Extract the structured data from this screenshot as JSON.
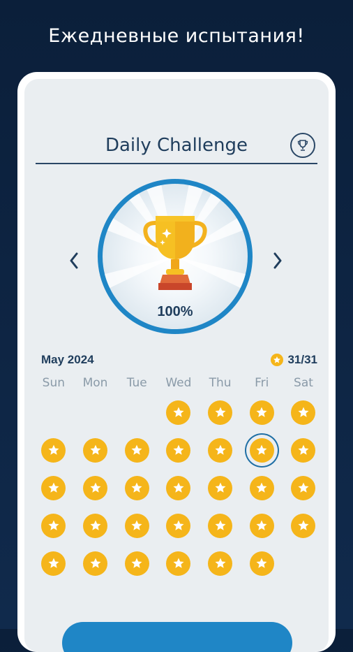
{
  "headline": "Ежедневные испытания!",
  "challenge": {
    "title": "Daily Challenge",
    "percent": "100%",
    "month": "May 2024",
    "score": "31/31"
  },
  "weekdays": [
    "Sun",
    "Mon",
    "Tue",
    "Wed",
    "Thu",
    "Fri",
    "Sat"
  ],
  "calendar": {
    "leading_empty_days": 3,
    "days_in_month": 31,
    "completed_days": 31,
    "selected_day": 10
  },
  "colors": {
    "accent": "#1f86c6",
    "star_gold": "#f5b51a",
    "text_dark": "#1f3d5c",
    "background": "#0d2240"
  },
  "icons": {
    "trophy_button": "trophy-outline-icon",
    "prev": "chevron-left-icon",
    "next": "chevron-right-icon",
    "day": "star-icon"
  }
}
